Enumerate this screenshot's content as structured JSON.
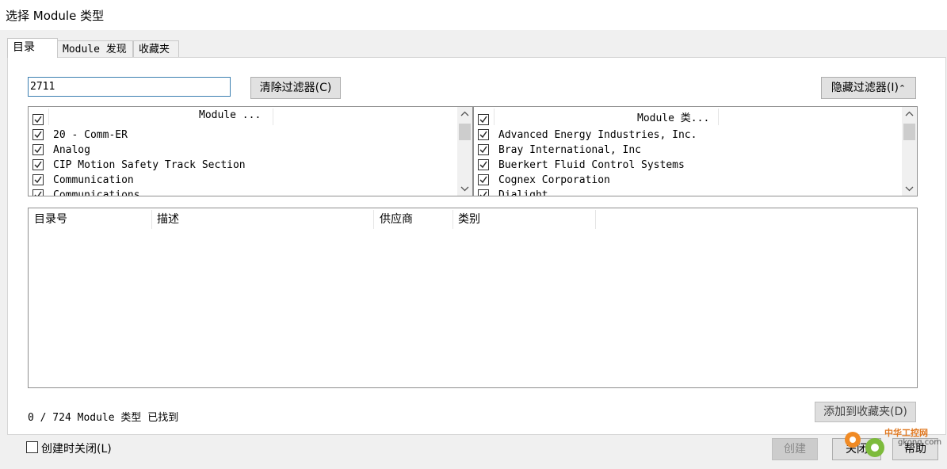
{
  "window": {
    "title": "选择 Module 类型"
  },
  "tabs": [
    {
      "label": "目录",
      "active": true
    },
    {
      "label": "Module 发现",
      "active": false
    },
    {
      "label": "收藏夹",
      "active": false
    }
  ],
  "filter": {
    "value": "2711",
    "clear_label": "清除过滤器(C)",
    "hide_label": "隐藏过滤器(I)"
  },
  "category_list": {
    "header": "Module ...",
    "items": [
      {
        "label": "20 - Comm-ER",
        "checked": true
      },
      {
        "label": "Analog",
        "checked": true
      },
      {
        "label": "CIP Motion Safety Track Section",
        "checked": true
      },
      {
        "label": "Communication",
        "checked": true
      },
      {
        "label": "Communications",
        "checked": true
      }
    ]
  },
  "vendor_list": {
    "header": "Module 类...",
    "items": [
      {
        "label": "Advanced Energy Industries, Inc.",
        "checked": true
      },
      {
        "label": "Bray International, Inc",
        "checked": true
      },
      {
        "label": "Buerkert Fluid Control Systems",
        "checked": true
      },
      {
        "label": "Cognex Corporation",
        "checked": true
      },
      {
        "label": "Dialight",
        "checked": true
      }
    ]
  },
  "results_table": {
    "columns": [
      "目录号",
      "描述",
      "供应商",
      "类别"
    ],
    "rows": []
  },
  "status": {
    "found_text": "0 / 724 Module 类型 已找到"
  },
  "buttons": {
    "add_favorite": "添加到收藏夹(D)",
    "create": "创建",
    "close": "关闭",
    "help": "帮助"
  },
  "close_on_create": {
    "label": "创建时关闭(L)",
    "checked": false
  },
  "watermark": {
    "line1": "中华工控网",
    "line2": "gkong.com"
  }
}
